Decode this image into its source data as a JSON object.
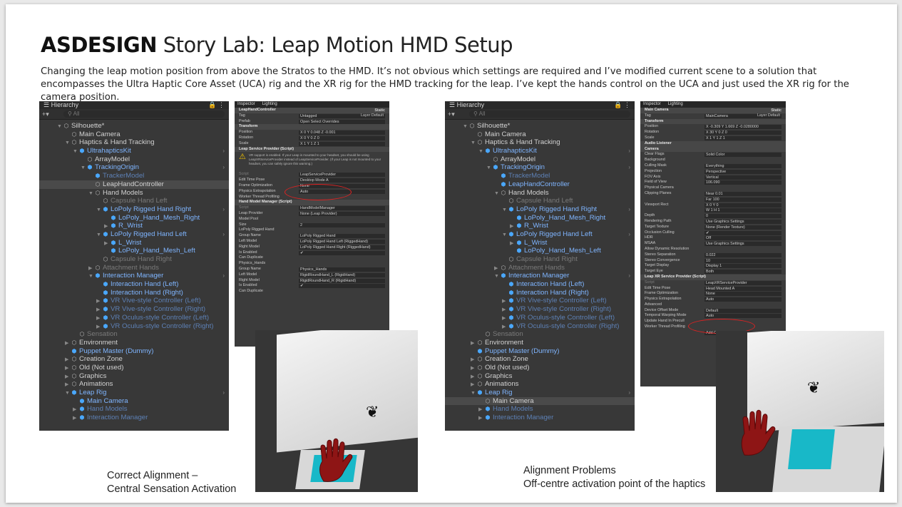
{
  "title": {
    "bold": "ASDESIGN",
    "rest": "Story Lab: Leap Motion HMD Setup"
  },
  "description": "Changing the leap motion position from above the Stratos to the HMD. It’s not obvious which settings are required and I’ve modified current scene to a solution that encompasses the Ultra Haptic Core Asset (UCA) rig and the XR rig for the HMD tracking for the leap. I’ve kept the hands control on the UCA and just used the XR rig for the camera position.",
  "captions": {
    "left_line1": "Correct Alignment –",
    "left_line2": "Central Sensation Activation",
    "right_line1": "Alignment Problems",
    "right_line2": "Off-centre activation point of the haptics"
  },
  "hierarchy_tab": "Hierarchy",
  "hierarchy_search": "All",
  "hierarchy_left": [
    {
      "t": "Silhouette*",
      "d": 1,
      "a": "▼",
      "c": ""
    },
    {
      "t": "Main Camera",
      "d": 2,
      "a": "",
      "c": ""
    },
    {
      "t": "Haptics & Hand Tracking",
      "d": 2,
      "a": "▼",
      "c": ""
    },
    {
      "t": "UltrahapticsKit",
      "d": 3,
      "a": "▼",
      "c": "blue"
    },
    {
      "t": "ArrayModel",
      "d": 4,
      "a": "",
      "c": ""
    },
    {
      "t": "TrackingOrigin",
      "d": 4,
      "a": "▼",
      "c": "blue"
    },
    {
      "t": "TrackerModel",
      "d": 5,
      "a": "",
      "c": "bluedim"
    },
    {
      "t": "LeapHandController",
      "d": 5,
      "a": "",
      "c": "sel"
    },
    {
      "t": "Hand Models",
      "d": 5,
      "a": "▼",
      "c": ""
    },
    {
      "t": "Capsule Hand Left",
      "d": 6,
      "a": "",
      "c": "dim"
    },
    {
      "t": "LoPoly Rigged Hand Right",
      "d": 6,
      "a": "▼",
      "c": "blue"
    },
    {
      "t": "LoPoly_Hand_Mesh_Right",
      "d": 7,
      "a": "",
      "c": "blue"
    },
    {
      "t": "R_Wrist",
      "d": 7,
      "a": "▶",
      "c": "blue"
    },
    {
      "t": "LoPoly Rigged Hand Left",
      "d": 6,
      "a": "▼",
      "c": "blue"
    },
    {
      "t": "L_Wrist",
      "d": 7,
      "a": "▶",
      "c": "blue"
    },
    {
      "t": "LoPoly_Hand_Mesh_Left",
      "d": 7,
      "a": "",
      "c": "blue"
    },
    {
      "t": "Capsule Hand Right",
      "d": 6,
      "a": "",
      "c": "dim"
    },
    {
      "t": "Attachment Hands",
      "d": 5,
      "a": "▶",
      "c": "dim"
    },
    {
      "t": "Interaction Manager",
      "d": 5,
      "a": "▼",
      "c": "blue"
    },
    {
      "t": "Interaction Hand (Left)",
      "d": 6,
      "a": "",
      "c": "blue"
    },
    {
      "t": "Interaction Hand (Right)",
      "d": 6,
      "a": "",
      "c": "blue"
    },
    {
      "t": "VR Vive-style Controller (Left)",
      "d": 6,
      "a": "▶",
      "c": "bluedim"
    },
    {
      "t": "VR Vive-style Controller (Right)",
      "d": 6,
      "a": "▶",
      "c": "bluedim"
    },
    {
      "t": "VR Oculus-style Controller (Left)",
      "d": 6,
      "a": "▶",
      "c": "bluedim"
    },
    {
      "t": "VR Oculus-style Controller (Right)",
      "d": 6,
      "a": "▶",
      "c": "bluedim"
    },
    {
      "t": "Sensation",
      "d": 3,
      "a": "",
      "c": "dim"
    },
    {
      "t": "Environment",
      "d": 2,
      "a": "▶",
      "c": ""
    },
    {
      "t": "Puppet Master (Dummy)",
      "d": 2,
      "a": "",
      "c": "blue"
    },
    {
      "t": "Creation Zone",
      "d": 2,
      "a": "▶",
      "c": ""
    },
    {
      "t": "Old (Not used)",
      "d": 2,
      "a": "▶",
      "c": ""
    },
    {
      "t": "Graphics",
      "d": 2,
      "a": "▶",
      "c": ""
    },
    {
      "t": "Animations",
      "d": 2,
      "a": "▶",
      "c": ""
    },
    {
      "t": "Leap Rig",
      "d": 2,
      "a": "▼",
      "c": "blue"
    },
    {
      "t": "Main Camera",
      "d": 3,
      "a": "",
      "c": "blue"
    },
    {
      "t": "Hand Models",
      "d": 3,
      "a": "▶",
      "c": "bluedim"
    },
    {
      "t": "Interaction Manager",
      "d": 3,
      "a": "▶",
      "c": "bluedim"
    }
  ],
  "hierarchy_right": [
    {
      "t": "Silhouette*",
      "d": 1,
      "a": "▼",
      "c": ""
    },
    {
      "t": "Main Camera",
      "d": 2,
      "a": "",
      "c": ""
    },
    {
      "t": "Haptics & Hand Tracking",
      "d": 2,
      "a": "▼",
      "c": ""
    },
    {
      "t": "UltrahapticsKit",
      "d": 3,
      "a": "▼",
      "c": "blue"
    },
    {
      "t": "ArrayModel",
      "d": 4,
      "a": "",
      "c": ""
    },
    {
      "t": "TrackingOrigin",
      "d": 4,
      "a": "▼",
      "c": "blue"
    },
    {
      "t": "TrackerModel",
      "d": 5,
      "a": "",
      "c": "bluedim"
    },
    {
      "t": "LeapHandController",
      "d": 5,
      "a": "",
      "c": "blue"
    },
    {
      "t": "Hand Models",
      "d": 5,
      "a": "▼",
      "c": ""
    },
    {
      "t": "Capsule Hand Left",
      "d": 6,
      "a": "",
      "c": "dim"
    },
    {
      "t": "LoPoly Rigged Hand Right",
      "d": 6,
      "a": "▼",
      "c": "blue"
    },
    {
      "t": "LoPoly_Hand_Mesh_Right",
      "d": 7,
      "a": "",
      "c": "blue"
    },
    {
      "t": "R_Wrist",
      "d": 7,
      "a": "▶",
      "c": "blue"
    },
    {
      "t": "LoPoly Rigged Hand Left",
      "d": 6,
      "a": "▼",
      "c": "blue"
    },
    {
      "t": "L_Wrist",
      "d": 7,
      "a": "▶",
      "c": "blue"
    },
    {
      "t": "LoPoly_Hand_Mesh_Left",
      "d": 7,
      "a": "",
      "c": "blue"
    },
    {
      "t": "Capsule Hand Right",
      "d": 6,
      "a": "",
      "c": "dim"
    },
    {
      "t": "Attachment Hands",
      "d": 5,
      "a": "▶",
      "c": "dim"
    },
    {
      "t": "Interaction Manager",
      "d": 5,
      "a": "▼",
      "c": "blue"
    },
    {
      "t": "Interaction Hand (Left)",
      "d": 6,
      "a": "",
      "c": "blue"
    },
    {
      "t": "Interaction Hand (Right)",
      "d": 6,
      "a": "",
      "c": "blue"
    },
    {
      "t": "VR Vive-style Controller (Left)",
      "d": 6,
      "a": "▶",
      "c": "bluedim"
    },
    {
      "t": "VR Vive-style Controller (Right)",
      "d": 6,
      "a": "▶",
      "c": "bluedim"
    },
    {
      "t": "VR Oculus-style Controller (Left)",
      "d": 6,
      "a": "▶",
      "c": "bluedim"
    },
    {
      "t": "VR Oculus-style Controller (Right)",
      "d": 6,
      "a": "▶",
      "c": "bluedim"
    },
    {
      "t": "Sensation",
      "d": 3,
      "a": "",
      "c": "dim"
    },
    {
      "t": "Environment",
      "d": 2,
      "a": "▶",
      "c": ""
    },
    {
      "t": "Puppet Master (Dummy)",
      "d": 2,
      "a": "",
      "c": "blue"
    },
    {
      "t": "Creation Zone",
      "d": 2,
      "a": "▶",
      "c": ""
    },
    {
      "t": "Old (Not used)",
      "d": 2,
      "a": "▶",
      "c": ""
    },
    {
      "t": "Graphics",
      "d": 2,
      "a": "▶",
      "c": ""
    },
    {
      "t": "Animations",
      "d": 2,
      "a": "▶",
      "c": ""
    },
    {
      "t": "Leap Rig",
      "d": 2,
      "a": "▼",
      "c": "blue"
    },
    {
      "t": "Main Camera",
      "d": 3,
      "a": "",
      "c": "sel"
    },
    {
      "t": "Hand Models",
      "d": 3,
      "a": "▶",
      "c": "bluedim"
    },
    {
      "t": "Interaction Manager",
      "d": 3,
      "a": "▶",
      "c": "bluedim"
    }
  ],
  "inspector_tabs": [
    "Inspector",
    "Lighting"
  ],
  "inspector_left": [
    {
      "k": "LeapHandController",
      "v": "Static",
      "s": "hdr"
    },
    {
      "k": "Tag",
      "v": "Untagged",
      "v2": "Layer  Default",
      "s": ""
    },
    {
      "k": "Prefab",
      "v": "Open        Select        Overrides",
      "s": ""
    },
    {
      "k": "Transform",
      "v": "",
      "s": "hdr"
    },
    {
      "k": "Position",
      "v": "X 0        Y 0.048        Z -0.001",
      "s": ""
    },
    {
      "k": "Rotation",
      "v": "X 0        Y 0        Z 0",
      "s": ""
    },
    {
      "k": "Scale",
      "v": "X 1        Y 1        Z 1",
      "s": ""
    },
    {
      "k": "Leap Service Provider (Script)",
      "v": "",
      "s": "hdr"
    },
    {
      "k": "__warn",
      "v": "VR support is enabled. If your Leap is mounted to your headset, you should be using LeapXRServiceProvider instead of LeapServiceProvider. (If your Leap is not mounted to your headset, you can safely ignore this warning.)",
      "s": ""
    },
    {
      "k": "Script",
      "v": "LeapServiceProvider",
      "s": "dim"
    },
    {
      "k": "Edit Time Pose",
      "v": "Desktop Mode A",
      "s": ""
    },
    {
      "k": "Frame Optimization",
      "v": "None",
      "s": ""
    },
    {
      "k": "Physics Extrapolation",
      "v": "Auto",
      "s": ""
    },
    {
      "k": "Worker Thread Profiling",
      "v": "",
      "s": ""
    },
    {
      "k": "Hand Model Manager (Script)",
      "v": "",
      "s": "hdr"
    },
    {
      "k": "Script",
      "v": "HandModelManager",
      "s": "dim"
    },
    {
      "k": "Leap Provider",
      "v": "None (Leap Provider)",
      "s": ""
    },
    {
      "k": "Model Pool",
      "v": "",
      "s": ""
    },
    {
      "k": "Size",
      "v": "2",
      "s": ""
    },
    {
      "k": "LoPoly Rigged Hand",
      "v": "",
      "s": ""
    },
    {
      "k": "Group Name",
      "v": "LoPoly Rigged Hand",
      "s": ""
    },
    {
      "k": "Left Model",
      "v": "LoPoly Rigged Hand Left (RiggedHand)",
      "s": ""
    },
    {
      "k": "Right Model",
      "v": "LoPoly Rigged Hand Right (RiggedHand)",
      "s": ""
    },
    {
      "k": "Is Enabled",
      "v": "✔",
      "s": ""
    },
    {
      "k": "Can Duplicate",
      "v": "",
      "s": ""
    },
    {
      "k": "Physics_Hands",
      "v": "",
      "s": ""
    },
    {
      "k": "Group Name",
      "v": "Physics_Hands",
      "s": ""
    },
    {
      "k": "Left Model",
      "v": "RigidRoundHand_L (RigidHand)",
      "s": ""
    },
    {
      "k": "Right Model",
      "v": "RigidRoundHand_R (RigidHand)",
      "s": ""
    },
    {
      "k": "Is Enabled",
      "v": "✔",
      "s": ""
    },
    {
      "k": "Can Duplicate",
      "v": "",
      "s": ""
    }
  ],
  "inspector_right": [
    {
      "k": "Main Camera",
      "v": "Static",
      "s": "hdr"
    },
    {
      "k": "Tag",
      "v": "MainCamera",
      "v2": "Layer  Default",
      "s": ""
    },
    {
      "k": "Transform",
      "v": "",
      "s": "hdr"
    },
    {
      "k": "Position",
      "v": "X -0.309     Y 1.669     Z -0.0280000",
      "s": ""
    },
    {
      "k": "Rotation",
      "v": "X 30     Y 0     Z 0",
      "s": ""
    },
    {
      "k": "Scale",
      "v": "X 1     Y 1     Z 1",
      "s": ""
    },
    {
      "k": "Audio Listener",
      "v": "",
      "s": "hdr"
    },
    {
      "k": "Camera",
      "v": "",
      "s": "hdr"
    },
    {
      "k": "Clear Flags",
      "v": "Solid Color",
      "s": ""
    },
    {
      "k": "Background",
      "v": "",
      "s": ""
    },
    {
      "k": "Culling Mask",
      "v": "Everything",
      "s": ""
    },
    {
      "k": "Projection",
      "v": "Perspective",
      "s": ""
    },
    {
      "k": "FOV Axis",
      "v": "Vertical",
      "s": ""
    },
    {
      "k": "Field of View",
      "v": "106.090",
      "s": ""
    },
    {
      "k": "Physical Camera",
      "v": "",
      "s": ""
    },
    {
      "k": "Clipping Planes",
      "v": "Near  0.01",
      "s": ""
    },
    {
      "k": "",
      "v": "Far   100",
      "s": ""
    },
    {
      "k": "Viewport Rect",
      "v": "X 0       Y 0",
      "s": ""
    },
    {
      "k": "",
      "v": "W 1       H 1",
      "s": ""
    },
    {
      "k": "Depth",
      "v": "0",
      "s": ""
    },
    {
      "k": "Rendering Path",
      "v": "Use Graphics Settings",
      "s": ""
    },
    {
      "k": "Target Texture",
      "v": "None (Render Texture)",
      "s": ""
    },
    {
      "k": "Occlusion Culling",
      "v": "✔",
      "s": ""
    },
    {
      "k": "HDR",
      "v": "Off",
      "s": ""
    },
    {
      "k": "MSAA",
      "v": "Use Graphics Settings",
      "s": ""
    },
    {
      "k": "Allow Dynamic Resolution",
      "v": "",
      "s": ""
    },
    {
      "k": "Stereo Separation",
      "v": "0.022",
      "s": ""
    },
    {
      "k": "Stereo Convergence",
      "v": "10",
      "s": ""
    },
    {
      "k": "Target Display",
      "v": "Display 1",
      "s": ""
    },
    {
      "k": "Target Eye",
      "v": "Both",
      "s": ""
    },
    {
      "k": "Leap XR Service Provider (Script)",
      "v": "",
      "s": "hdr"
    },
    {
      "k": "Script",
      "v": "LeapXRServiceProvider",
      "s": "dim"
    },
    {
      "k": "Edit Time Pose",
      "v": "Head Mounted A",
      "s": ""
    },
    {
      "k": "Frame Optimization",
      "v": "None",
      "s": ""
    },
    {
      "k": "Physics Extrapolation",
      "v": "Auto",
      "s": ""
    },
    {
      "k": "Advanced",
      "v": "",
      "s": ""
    },
    {
      "k": "Device Offset Mode",
      "v": "Default",
      "s": ""
    },
    {
      "k": "Temporal Warping Mode",
      "v": "Auto",
      "s": ""
    },
    {
      "k": "Update Hand In Precull",
      "v": "",
      "s": ""
    },
    {
      "k": "Worker Thread Profiling",
      "v": "",
      "s": ""
    },
    {
      "k": "",
      "v": "Add Component",
      "s": ""
    }
  ],
  "colors": {
    "panel_bg": "#383838",
    "highlight_blue": "#7fb5ff",
    "annotation_red": "#dd2222",
    "pad_cyan": "#18b8c8"
  }
}
